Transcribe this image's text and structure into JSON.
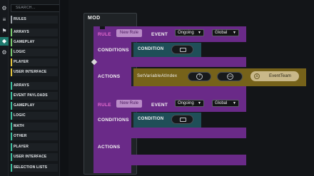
{
  "sidebar": {
    "search_placeholder": "SEARCH...",
    "categories_top": [
      {
        "label": "RULES",
        "color": "#9a9fa5"
      },
      {
        "label": "ARRAYS",
        "color": "#7bc96f"
      },
      {
        "label": "GAMEPLAY",
        "color": "#7bc96f"
      },
      {
        "label": "LOGIC",
        "color": "#7bc96f"
      },
      {
        "label": "PLAYER",
        "color": "#e3c43f"
      },
      {
        "label": "USER INTERFACE",
        "color": "#e3c43f"
      }
    ],
    "categories_bottom": [
      {
        "label": "ARRAYS",
        "color": "#3fbfa0"
      },
      {
        "label": "EVENT PAYLOADS",
        "color": "#3fbfa0"
      },
      {
        "label": "GAMEPLAY",
        "color": "#3fbfa0"
      },
      {
        "label": "LOGIC",
        "color": "#3fbfa0"
      },
      {
        "label": "MATH",
        "color": "#3fbfa0"
      },
      {
        "label": "OTHER",
        "color": "#3fbfa0"
      },
      {
        "label": "PLAYER",
        "color": "#3fbfa0"
      },
      {
        "label": "USER INTERFACE",
        "color": "#3fbfa0"
      },
      {
        "label": "SELECTION LISTS",
        "color": "#3fbfa0"
      }
    ]
  },
  "mod": {
    "label": "MOD"
  },
  "rules": [
    {
      "rule_label": "RULE",
      "new_rule": "New Rule",
      "event_label": "EVENT",
      "event_value": "Ongoing",
      "scope_value": "Global",
      "conditions_label": "CONDITIONS",
      "condition_label": "CONDITION",
      "actions_label": "ACTIONS",
      "action_name": "SetVariableAtIndex",
      "action_arg": "EventTeam"
    },
    {
      "rule_label": "RULE",
      "new_rule": "New Rule",
      "event_label": "EVENT",
      "event_value": "Ongoing",
      "scope_value": "Global",
      "conditions_label": "CONDITIONS",
      "condition_label": "CONDITION",
      "actions_label": "ACTIONS"
    }
  ],
  "colors": {
    "rule_purple": "#6a2a88",
    "condition_teal": "#1f4f58",
    "action_olive": "#76621a",
    "eventteam_pill": "#c9b889"
  }
}
